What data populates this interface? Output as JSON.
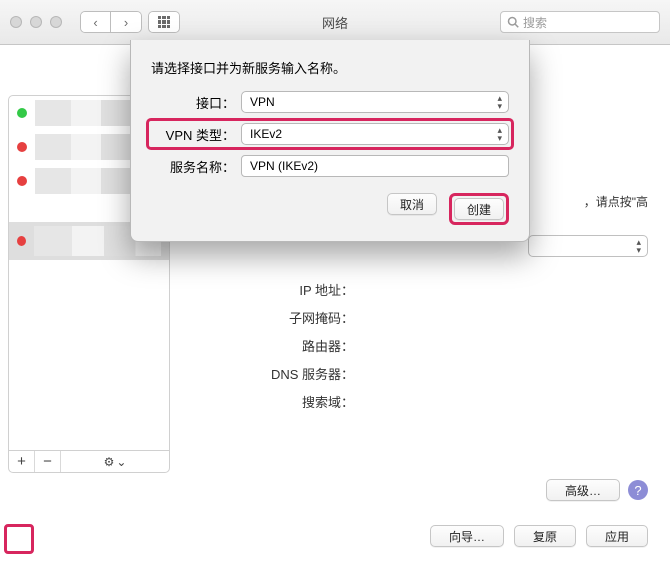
{
  "window": {
    "title": "网络",
    "search_placeholder": "搜索"
  },
  "toolbar": {
    "back": "‹",
    "forward": "›"
  },
  "sheet": {
    "prompt": "请选择接口并为新服务输入名称。",
    "interface_label": "接口：",
    "interface_value": "VPN",
    "vpntype_label": "VPN 类型：",
    "vpntype_value": "IKEv2",
    "servicename_label": "服务名称：",
    "servicename_value": "VPN (IKEv2)",
    "cancel": "取消",
    "create": "创建"
  },
  "content": {
    "hint": "，请点按\"高",
    "ip": "IP 地址：",
    "subnet": "子网掩码：",
    "router": "路由器：",
    "dns": "DNS 服务器：",
    "searchdomain": "搜索域：",
    "advanced": "高级…",
    "assist": "向导…",
    "revert": "复原",
    "apply": "应用"
  },
  "sidebar": {
    "plus": "+",
    "minus": "−",
    "gear": "⚙"
  }
}
